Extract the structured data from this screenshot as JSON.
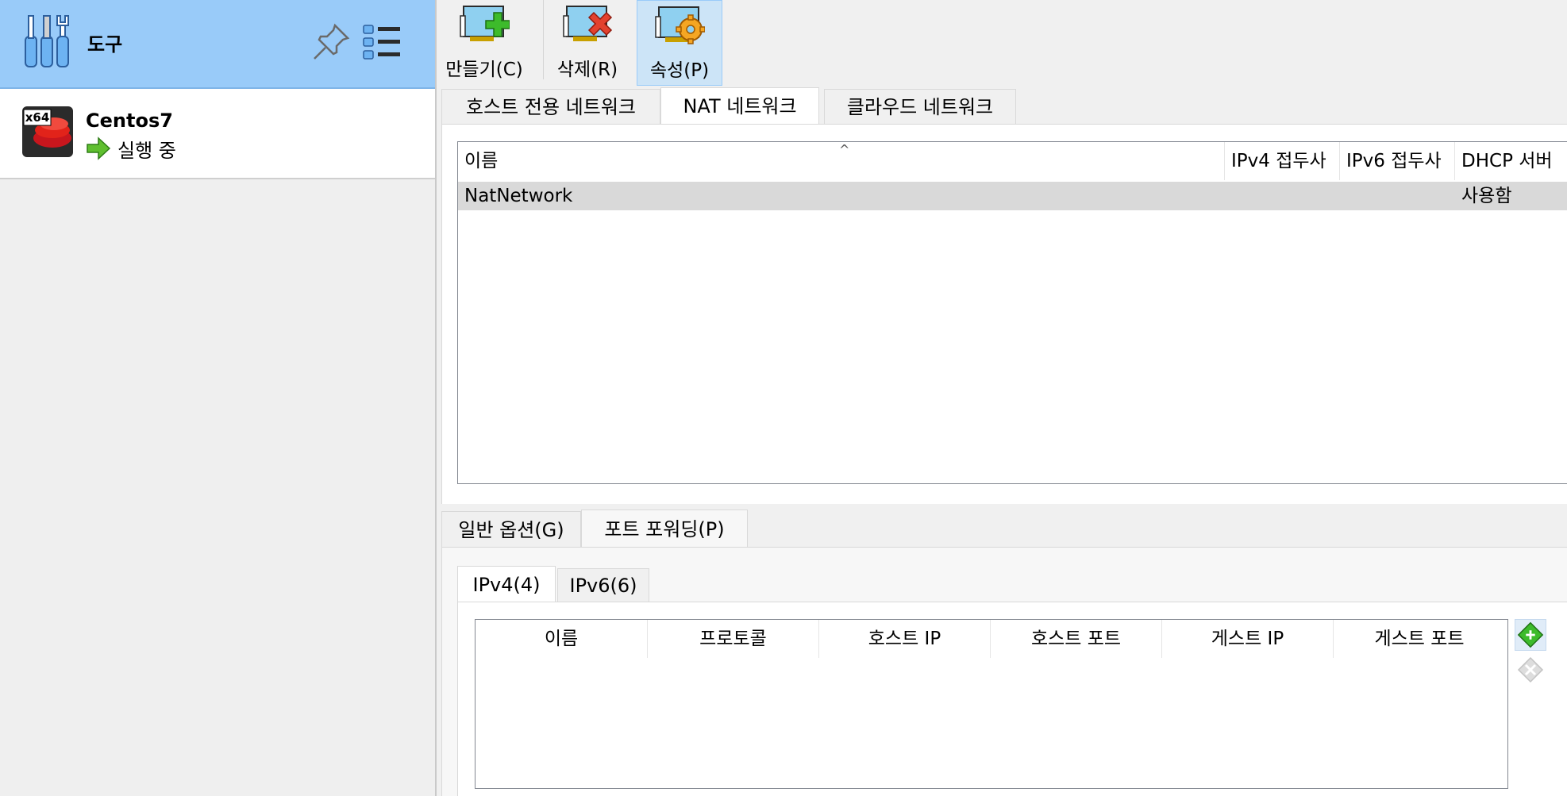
{
  "sidebar": {
    "tools_label": "도구",
    "vm": {
      "name": "Centos7",
      "state": "실행 중",
      "os_badge": "x64"
    }
  },
  "toolbar": {
    "create_label": "만들기(C)",
    "delete_label": "삭제(R)",
    "properties_label": "속성(P)"
  },
  "network_tabs": [
    {
      "label": "호스트 전용 네트워크"
    },
    {
      "label": "NAT 네트워크"
    },
    {
      "label": "클라우드 네트워크"
    }
  ],
  "network_table": {
    "columns": [
      "이름",
      "IPv4 접두사",
      "IPv6 접두사",
      "DHCP 서버"
    ],
    "rows": [
      {
        "name": "NatNetwork",
        "ipv4": "",
        "ipv6": "",
        "dhcp": "사용함"
      }
    ]
  },
  "options_tabs": [
    {
      "label": "일반 옵션(G)"
    },
    {
      "label": "포트 포워딩(P)"
    }
  ],
  "ip_tabs": [
    {
      "label": "IPv4(4)"
    },
    {
      "label": "IPv6(6)"
    }
  ],
  "port_forward_table": {
    "columns": [
      "이름",
      "프로토콜",
      "호스트 IP",
      "호스트 포트",
      "게스트 IP",
      "게스트 포트"
    ],
    "rows": []
  },
  "colors": {
    "tools_highlight": "#99cbf9",
    "selected_toolbar_button": "#cce4f7",
    "selected_row": "#d9d9d9"
  }
}
